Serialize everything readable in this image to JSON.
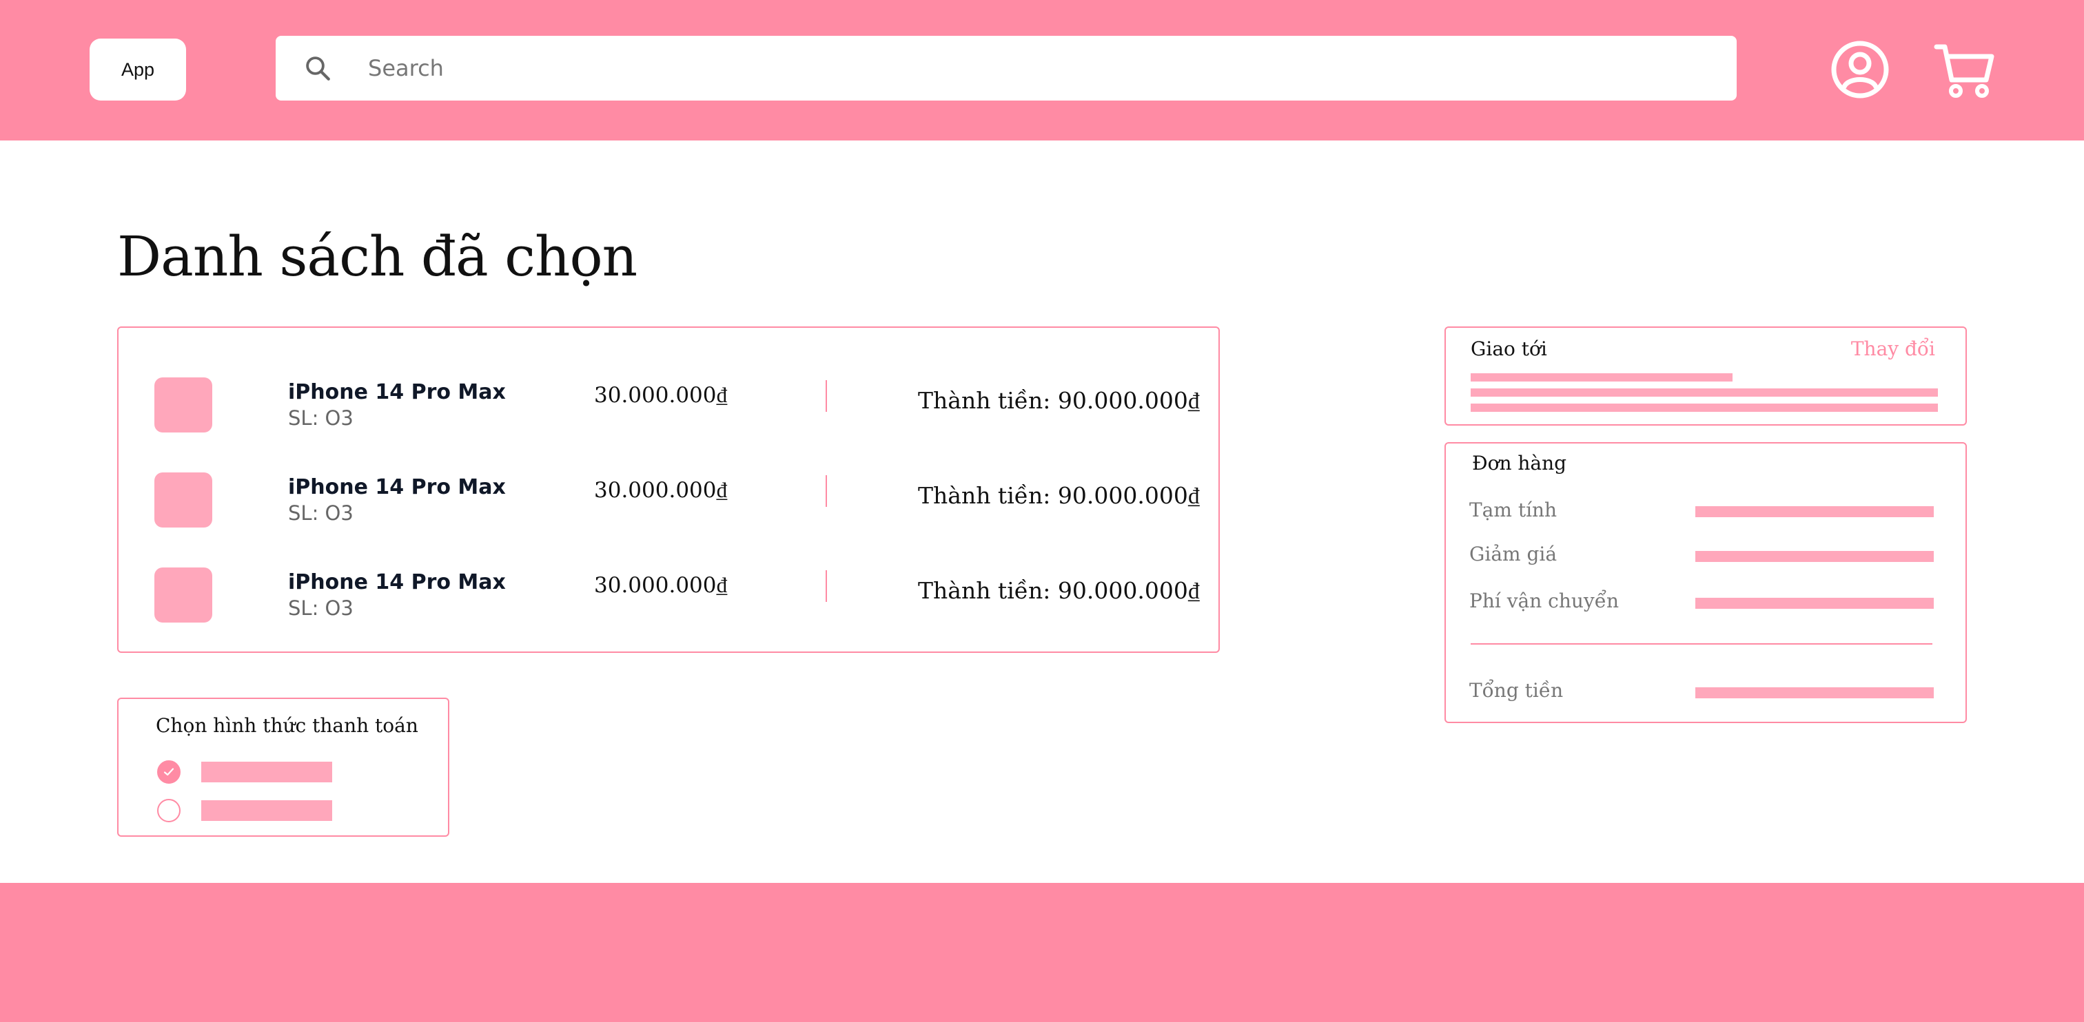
{
  "header": {
    "logo_label": "App",
    "search": {
      "placeholder": "Search"
    }
  },
  "page": {
    "title": "Danh sách đã chọn"
  },
  "cart": {
    "items": [
      {
        "name": "iPhone 14 Pro Max",
        "qty": "SL: O3",
        "price": "30.000.000₫",
        "total": "Thành tiền: 90.000.000₫"
      },
      {
        "name": "iPhone 14 Pro Max",
        "qty": "SL: O3",
        "price": "30.000.000₫",
        "total": "Thành tiền: 90.000.000₫"
      },
      {
        "name": "iPhone 14 Pro Max",
        "qty": "SL: O3",
        "price": "30.000.000₫",
        "total": "Thành tiền: 90.000.000₫"
      }
    ]
  },
  "payment": {
    "title": "Chọn hình thức thanh toán",
    "options": [
      {
        "selected": true
      },
      {
        "selected": false
      }
    ]
  },
  "shipping": {
    "title": "Giao tới",
    "change_label": "Thay đổi"
  },
  "order": {
    "title": "Đơn hàng",
    "subtotal_label": "Tạm tính",
    "discount_label": "Giảm giá",
    "shipping_fee_label": "Phí vận chuyển",
    "total_label": "Tổng tiền"
  },
  "colors": {
    "brand": "#ff8ba4",
    "placeholder_block": "#ffa7bb"
  }
}
